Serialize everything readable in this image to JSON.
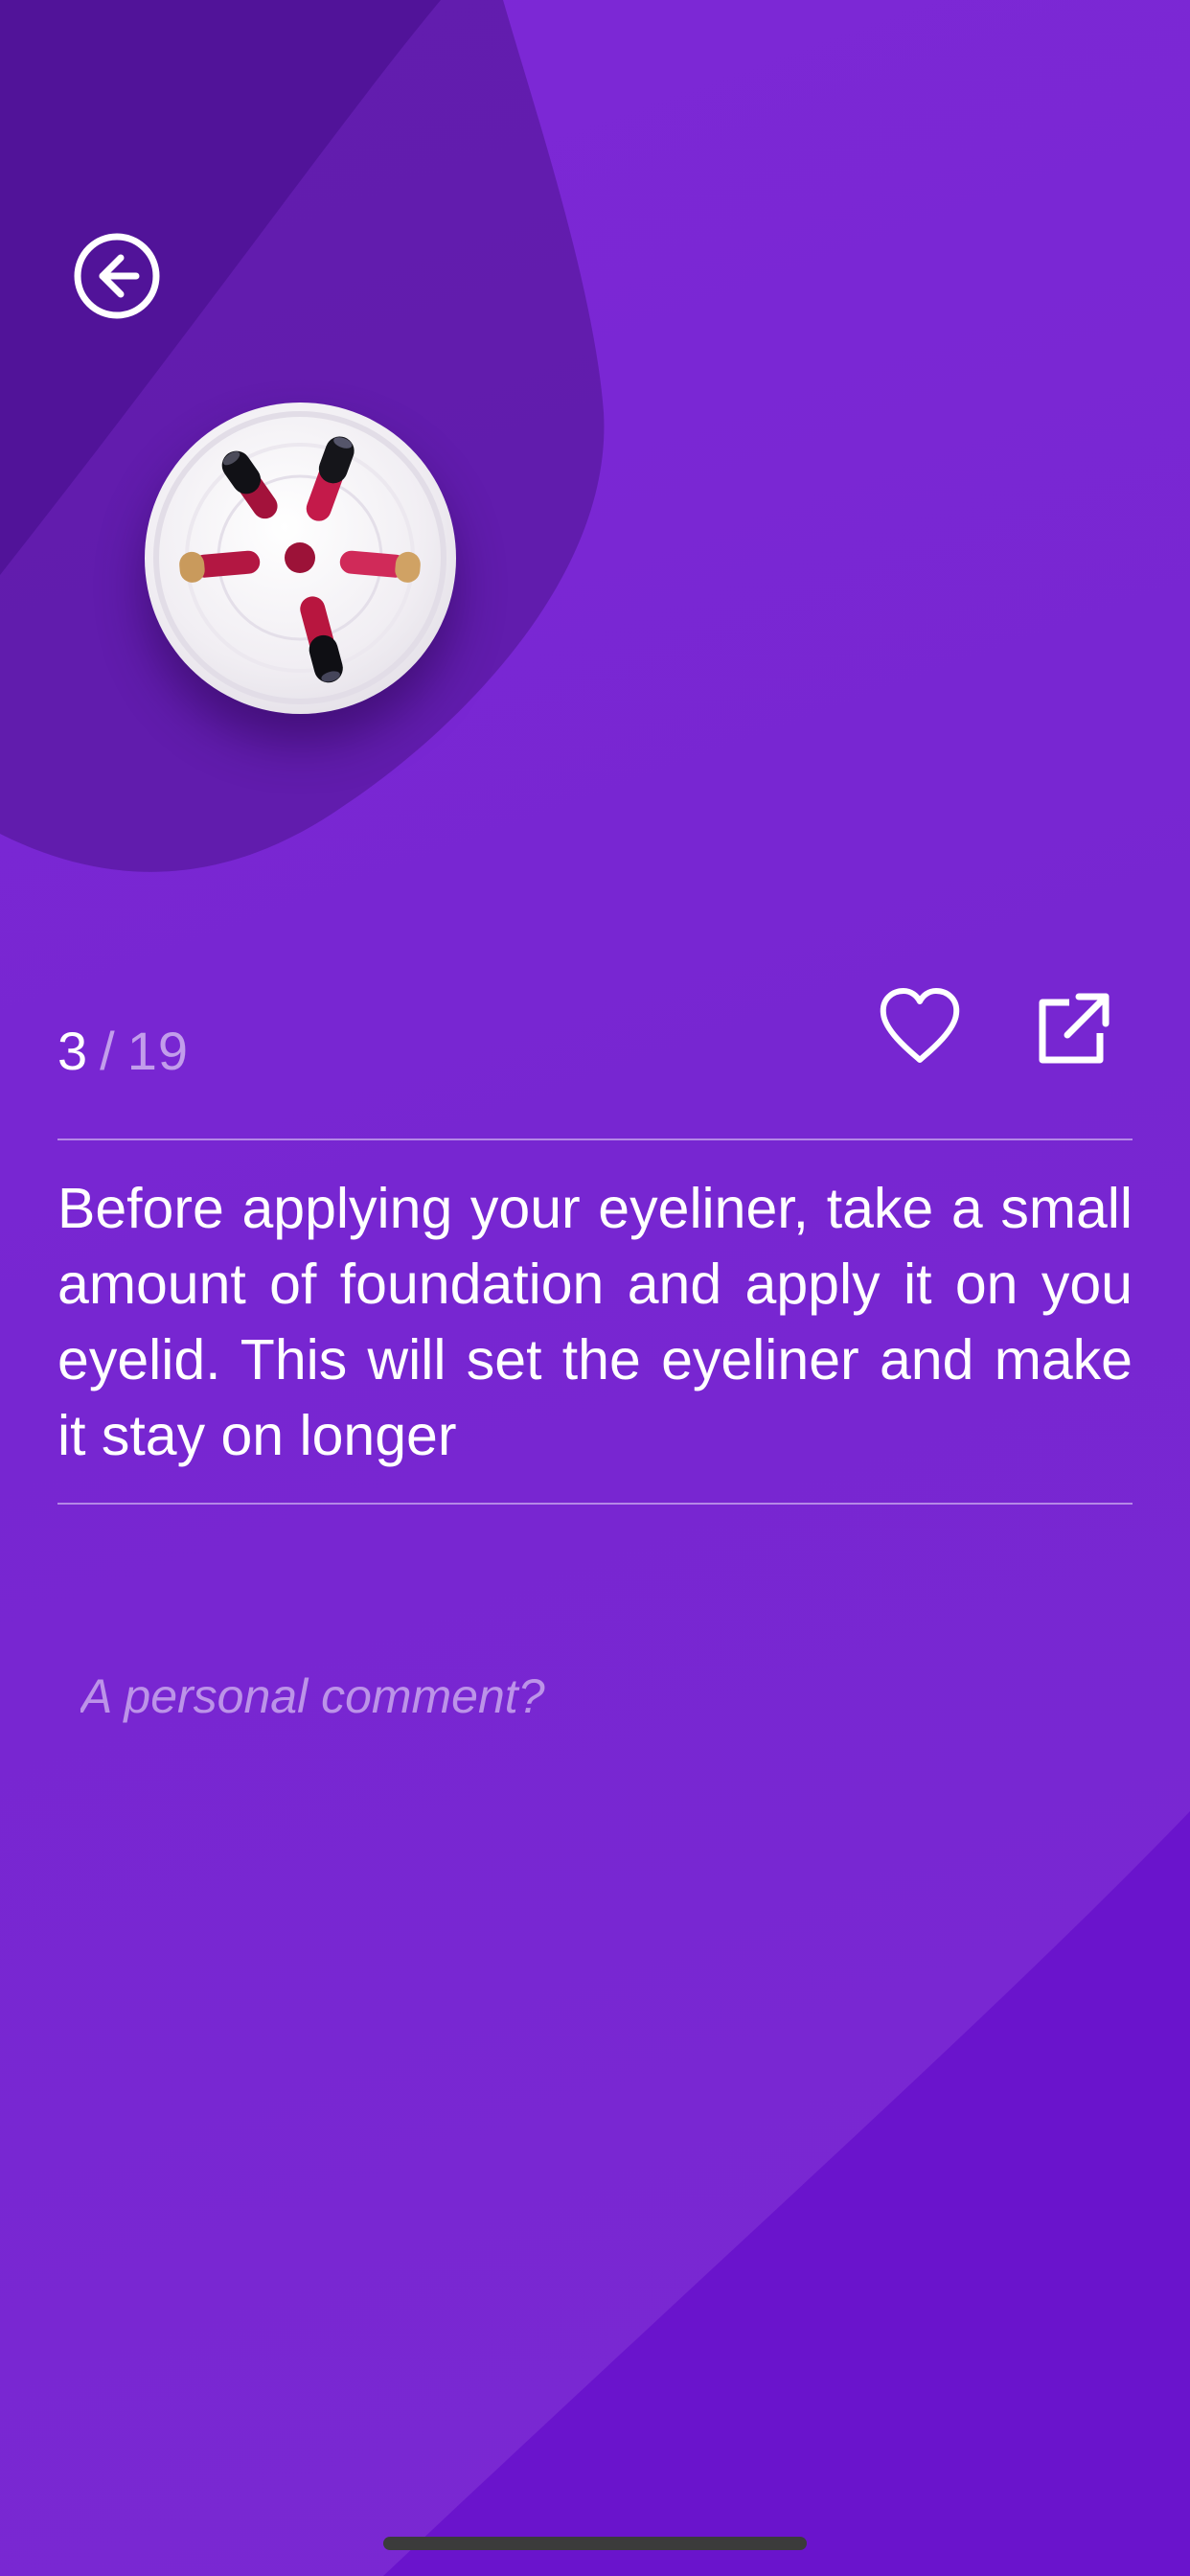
{
  "colors": {
    "background": "#7a24d3",
    "blob_dark": "#4e128d",
    "blob_mid": "#5f1aa6",
    "bottom_shape": "#6b15cc",
    "text": "#ffffff",
    "divider": "#b58be8"
  },
  "header": {
    "back_icon": "arrow-left-circle-icon"
  },
  "tip": {
    "image_description": "lipsticks-in-glass",
    "counter": {
      "current": "3",
      "separator": "/",
      "total": "19"
    },
    "actions": {
      "like_icon": "heart-outline-icon",
      "share_icon": "external-link-icon"
    },
    "text": "Before applying your eyeliner, take a small amount of foundation and apply it on you eyelid. This will set the eyeliner and make it stay on longer"
  },
  "comment": {
    "placeholder": "A personal comment?",
    "value": ""
  }
}
